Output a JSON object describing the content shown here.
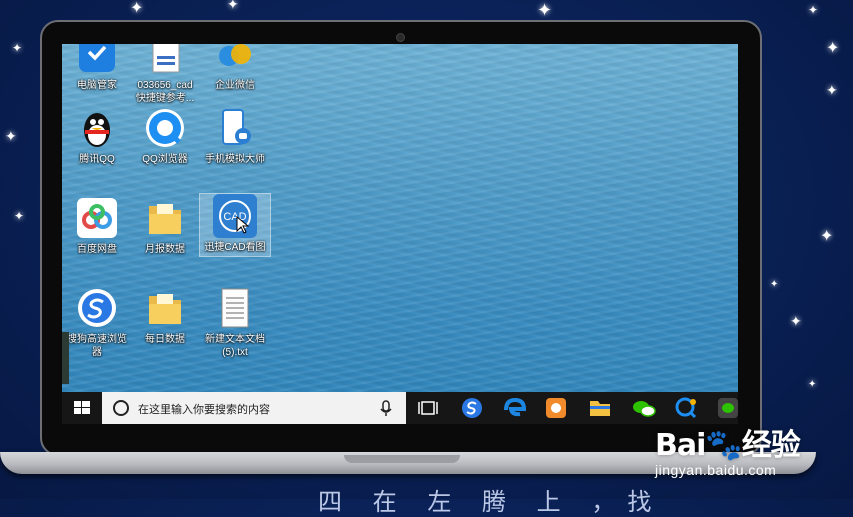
{
  "desktop": {
    "icons": [
      {
        "label": "电脑管家",
        "icon": "shield-icon"
      },
      {
        "label": "033656_cad\n快捷键参考...",
        "icon": "document-icon"
      },
      {
        "label": "企业微信",
        "icon": "chat-icon"
      },
      {
        "label": "腾讯QQ",
        "icon": "penguin-icon"
      },
      {
        "label": "QQ浏览器",
        "icon": "browser-icon"
      },
      {
        "label": "手机模拟大师",
        "icon": "phone-icon"
      },
      {
        "label": "百度网盘",
        "icon": "cloud-icon"
      },
      {
        "label": "月报数据",
        "icon": "folder-icon"
      },
      {
        "label": "迅捷CAD看图",
        "icon": "cad-icon",
        "cad_text": "CAD"
      },
      {
        "label": "搜狗高速浏览\n器",
        "icon": "sogou-icon"
      },
      {
        "label": "每日数据",
        "icon": "folder-icon"
      },
      {
        "label": "新建文本文档\n(5).txt",
        "icon": "text-file-icon"
      }
    ]
  },
  "taskbar": {
    "search_placeholder": "在这里输入你要搜索的内容",
    "pinned": [
      "task-view-icon",
      "sogou-browser-icon",
      "edge-icon",
      "uc-icon",
      "file-explorer-icon",
      "wechat-icon",
      "qq-browser-icon",
      "wechat-app-icon"
    ]
  },
  "watermark": {
    "logo": "Bai🐾经验",
    "url": "jingyan.baidu.com"
  },
  "bottom_text": "四 在 左 腾 上 ，找",
  "colors": {
    "sea": "#3a8ec3",
    "taskbar": "#161616",
    "background": "#0a2258"
  }
}
